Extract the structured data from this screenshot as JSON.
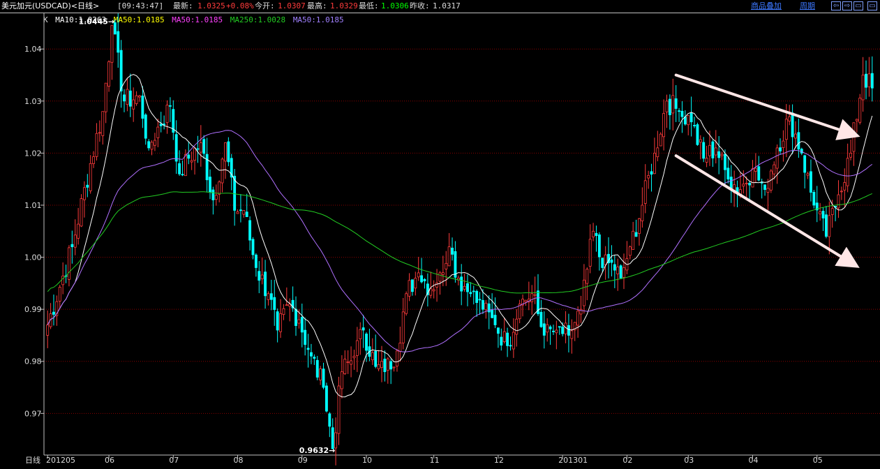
{
  "header": {
    "title": "美元加元(USDCAD)<日线>",
    "time": "[09:43:47]",
    "latest_label": "最新:",
    "latest_value": "1.0325",
    "change": "+0.08%",
    "open_label": "今开:",
    "open_value": "1.0307",
    "high_label": "最高:",
    "high_value": "1.0329",
    "low_label": "最低:",
    "low_value": "1.0306",
    "prev_close_label": "昨收:",
    "prev_close_value": "1.0317",
    "overlay_link": "商品叠加",
    "period_link": "周期"
  },
  "window_buttons": [
    "⇦",
    "⇨",
    "▭",
    "▭"
  ],
  "ma_bar": {
    "k": "K",
    "ma10": "MA10:1.0263",
    "ma50a": "MA50:1.0185",
    "ma50b": "MA50:1.0185",
    "ma250": "MA250:1.0028",
    "ma50c": "MA50:1.0185"
  },
  "colors": {
    "bg": "#000000",
    "up": "#ff3b3b",
    "down": "#00ffff",
    "ma10": "#ffffff",
    "ma50": "#b070ff",
    "ma250": "#22cc22",
    "grid": "#8b0000",
    "axis": "#c0c0c0",
    "arrow": "#ffe6e6",
    "link": "#3c78ff",
    "green": "#00ff00",
    "red": "#ff3b3b",
    "yellow": "#ffff00",
    "magenta": "#ff40ff",
    "violet": "#a080ff"
  },
  "chart_data": {
    "type": "candlestick",
    "title": "美元加元(USDCAD)<日线>",
    "ylim": [
      0.962,
      1.047
    ],
    "y_ticks": [
      "0.97",
      "0.98",
      "0.99",
      "1.00",
      "1.01",
      "1.02",
      "1.03",
      "1.04"
    ],
    "y_tick_values": [
      0.97,
      0.98,
      0.99,
      1.0,
      1.01,
      1.02,
      1.03,
      1.04
    ],
    "x_axis_label": "日线",
    "month_labels": [
      "201205",
      "06",
      "07",
      "08",
      "09",
      "10",
      "11",
      "12",
      "201301",
      "02",
      "03",
      "04",
      "05"
    ],
    "month_start_index": [
      0,
      20,
      41,
      62,
      83,
      104,
      126,
      147,
      168,
      189,
      209,
      230,
      251
    ],
    "bars": 270,
    "close_anchors": [
      [
        0,
        0.987
      ],
      [
        8,
        1.002
      ],
      [
        14,
        1.018
      ],
      [
        18,
        1.028
      ],
      [
        21,
        1.0445
      ],
      [
        25,
        1.03
      ],
      [
        30,
        1.031
      ],
      [
        33,
        1.021
      ],
      [
        36,
        1.025
      ],
      [
        40,
        1.029
      ],
      [
        43,
        1.016
      ],
      [
        46,
        1.019
      ],
      [
        50,
        1.022
      ],
      [
        54,
        1.011
      ],
      [
        58,
        1.022
      ],
      [
        61,
        1.009
      ],
      [
        64,
        1.009
      ],
      [
        68,
        0.998
      ],
      [
        72,
        0.993
      ],
      [
        75,
        0.986
      ],
      [
        79,
        0.991
      ],
      [
        82,
        0.988
      ],
      [
        86,
        0.981
      ],
      [
        90,
        0.975
      ],
      [
        93,
        0.9632
      ],
      [
        96,
        0.978
      ],
      [
        100,
        0.981
      ],
      [
        103,
        0.986
      ],
      [
        107,
        0.979
      ],
      [
        110,
        0.978
      ],
      [
        114,
        0.982
      ],
      [
        117,
        0.993
      ],
      [
        121,
        0.997
      ],
      [
        125,
        0.994
      ],
      [
        128,
        0.997
      ],
      [
        131,
        1.002
      ],
      [
        134,
        0.996
      ],
      [
        138,
        0.993
      ],
      [
        142,
        0.99
      ],
      [
        146,
        0.987
      ],
      [
        150,
        0.983
      ],
      [
        154,
        0.991
      ],
      [
        158,
        0.993
      ],
      [
        162,
        0.985
      ],
      [
        166,
        0.986
      ],
      [
        170,
        0.985
      ],
      [
        174,
        0.99
      ],
      [
        178,
        1.005
      ],
      [
        181,
        0.998
      ],
      [
        184,
        0.999
      ],
      [
        187,
        0.996
      ],
      [
        190,
        1.002
      ],
      [
        194,
        1.01
      ],
      [
        198,
        1.02
      ],
      [
        202,
        1.03
      ],
      [
        206,
        1.028
      ],
      [
        210,
        1.026
      ],
      [
        214,
        1.019
      ],
      [
        218,
        1.021
      ],
      [
        222,
        1.015
      ],
      [
        226,
        1.013
      ],
      [
        230,
        1.017
      ],
      [
        234,
        1.013
      ],
      [
        238,
        1.021
      ],
      [
        242,
        1.027
      ],
      [
        246,
        1.02
      ],
      [
        250,
        1.01
      ],
      [
        254,
        1.004
      ],
      [
        258,
        1.012
      ],
      [
        262,
        1.02
      ],
      [
        266,
        1.035
      ],
      [
        269,
        1.0325
      ]
    ],
    "ma10_last": 1.0263,
    "ma50_last": 1.0185,
    "ma250_last": 1.0028,
    "annotations": [
      {
        "text": "1.0445",
        "bar": 21,
        "value": 1.0445,
        "side": "high"
      },
      {
        "text": "0.9632",
        "bar": 93,
        "value": 0.9632,
        "side": "low"
      }
    ],
    "trend_lines": [
      {
        "from": [
          205,
          1.035
        ],
        "to": [
          270,
          1.0235
        ]
      },
      {
        "from": [
          205,
          1.0195
        ],
        "to": [
          270,
          0.9985
        ]
      }
    ]
  }
}
